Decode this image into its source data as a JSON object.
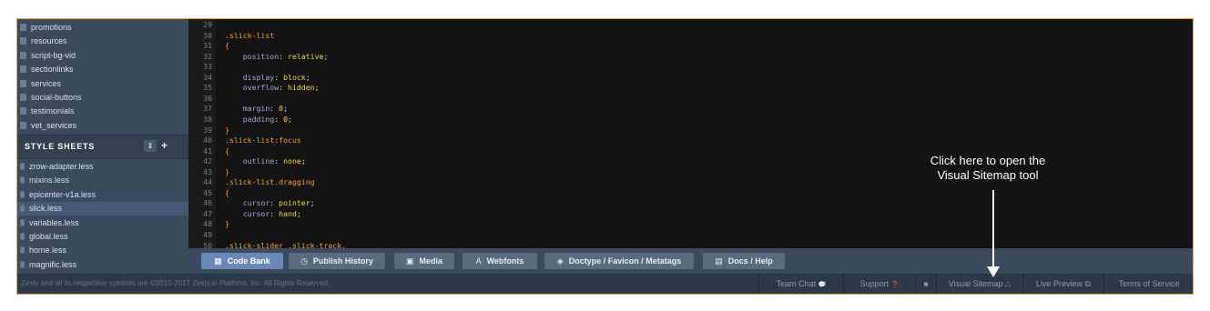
{
  "sidebar": {
    "files": [
      "promotions",
      "resources",
      "script-bg-vid",
      "sectionlinks",
      "services",
      "social-buttons",
      "testimonials",
      "vet_services"
    ],
    "style_sheets_header": "STYLE SHEETS",
    "sort_icon": "⇕",
    "add_icon": "+",
    "style_sheets": [
      "zrow-adapter.less",
      "mixins.less",
      "epicenter-v1a.less",
      "slick.less",
      "variables.less",
      "global.less",
      "home.less",
      "magnific.less"
    ],
    "active_style_sheet": "slick.less"
  },
  "editor": {
    "line_numbers": [
      "29",
      "30",
      "31",
      "32",
      "33",
      "34",
      "35",
      "36",
      "37",
      "38",
      "39",
      "40",
      "41",
      "42",
      "43",
      "44",
      "45",
      "46",
      "47",
      "48",
      "49",
      "50"
    ],
    "lines": [
      [],
      [
        {
          "t": ".slick-list",
          "c": "c-sel"
        }
      ],
      [
        {
          "t": "{",
          "c": "c-br"
        }
      ],
      [
        {
          "t": "    position",
          "c": "c-prop"
        },
        {
          "t": ": ",
          "c": "c-punc"
        },
        {
          "t": "relative",
          "c": "c-val"
        },
        {
          "t": ";",
          "c": "c-punc"
        }
      ],
      [],
      [
        {
          "t": "    display",
          "c": "c-prop"
        },
        {
          "t": ": ",
          "c": "c-punc"
        },
        {
          "t": "block",
          "c": "c-val"
        },
        {
          "t": ";",
          "c": "c-punc"
        }
      ],
      [
        {
          "t": "    overflow",
          "c": "c-prop"
        },
        {
          "t": ": ",
          "c": "c-punc"
        },
        {
          "t": "hidden",
          "c": "c-val"
        },
        {
          "t": ";",
          "c": "c-punc"
        }
      ],
      [],
      [
        {
          "t": "    margin",
          "c": "c-prop"
        },
        {
          "t": ": ",
          "c": "c-punc"
        },
        {
          "t": "0",
          "c": "c-num"
        },
        {
          "t": ";",
          "c": "c-punc"
        }
      ],
      [
        {
          "t": "    padding",
          "c": "c-prop"
        },
        {
          "t": ": ",
          "c": "c-punc"
        },
        {
          "t": "0",
          "c": "c-num"
        },
        {
          "t": ";",
          "c": "c-punc"
        }
      ],
      [
        {
          "t": "}",
          "c": "c-br"
        }
      ],
      [
        {
          "t": ".slick-list:focus",
          "c": "c-sel"
        }
      ],
      [
        {
          "t": "{",
          "c": "c-br"
        }
      ],
      [
        {
          "t": "    outline",
          "c": "c-prop"
        },
        {
          "t": ": ",
          "c": "c-punc"
        },
        {
          "t": "none",
          "c": "c-val"
        },
        {
          "t": ";",
          "c": "c-punc"
        }
      ],
      [
        {
          "t": "}",
          "c": "c-br"
        }
      ],
      [
        {
          "t": ".slick-list.dragging",
          "c": "c-sel"
        }
      ],
      [
        {
          "t": "{",
          "c": "c-br"
        }
      ],
      [
        {
          "t": "    cursor",
          "c": "c-prop"
        },
        {
          "t": ": ",
          "c": "c-punc"
        },
        {
          "t": "pointer",
          "c": "c-val"
        },
        {
          "t": ";",
          "c": "c-punc"
        }
      ],
      [
        {
          "t": "    cursor",
          "c": "c-prop"
        },
        {
          "t": ": ",
          "c": "c-punc"
        },
        {
          "t": "hand",
          "c": "c-val"
        },
        {
          "t": ";",
          "c": "c-punc"
        }
      ],
      [
        {
          "t": "}",
          "c": "c-br"
        }
      ],
      [],
      [
        {
          "t": ".slick-slider .slick-track,",
          "c": "c-sel"
        }
      ]
    ]
  },
  "toolbar": {
    "buttons": [
      {
        "label": "Code Bank",
        "icon": "▦",
        "icon_name": "grid-icon"
      },
      {
        "label": "Publish History",
        "icon": "◷",
        "icon_name": "clock-icon"
      },
      {
        "label": "Media",
        "icon": "▣",
        "icon_name": "image-icon"
      },
      {
        "label": "Webfonts",
        "icon": "A",
        "icon_name": "font-icon"
      },
      {
        "label": "Doctype / Favicon / Metatags",
        "icon": "◈",
        "icon_name": "tag-icon"
      },
      {
        "label": "Docs / Help",
        "icon": "▤",
        "icon_name": "document-icon"
      }
    ]
  },
  "footer": {
    "copyright": "Zesty and all its respective symbols are ©2010-2017 Zesty.io Platform, Inc. All Rights Reserved.",
    "team_chat": "Team Chat",
    "team_chat_icon": "💬",
    "support": "Support",
    "support_icon": "❓",
    "camera_icon": "■",
    "visual_sitemap": "Visual Sitemap",
    "visual_sitemap_icon": "⛬",
    "live_preview": "Live Preview",
    "live_preview_icon": "⧉",
    "terms": "Terms of Service"
  },
  "annotation": {
    "line1": "Click here to open the",
    "line2": "Visual Sitemap tool"
  },
  "colors": {
    "sidebar_bg": "#3b4a5e",
    "editor_bg": "#141414",
    "selector": "#f0a23c",
    "property": "#a7a7df",
    "value": "#f3d44f",
    "active_button": "#6a88b5",
    "frame_border": "#e6a855"
  }
}
